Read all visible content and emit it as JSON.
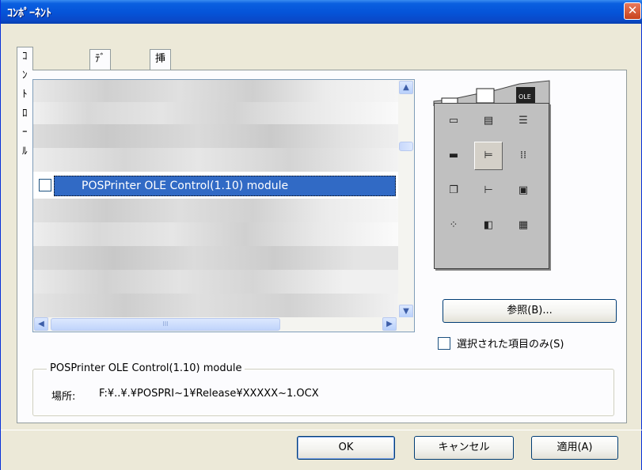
{
  "window": {
    "title": "ｺﾝﾎﾟｰﾈﾝﾄ",
    "close_glyph": "✕"
  },
  "tabs": [
    {
      "label": "ｺﾝﾄﾛｰﾙ",
      "active": true
    },
    {
      "label": "ﾃﾞｻﾞｲﾅ",
      "active": false
    },
    {
      "label": "挿入可能なｵﾌﾞｼﾞｪｸﾄ",
      "active": false
    }
  ],
  "list": {
    "selected_item": "POSPrinter OLE Control(1.10) module"
  },
  "scroll": {
    "up": "▲",
    "down": "▼",
    "left": "◀",
    "right": "▶",
    "grip": "III"
  },
  "palette": {
    "icons": [
      "chart-icon",
      "stack-icon",
      "ole-icon",
      "frame-icon",
      "label-icon",
      "form-icon",
      "rect-icon",
      "tree-icon",
      "grid-icon",
      "window-icon",
      "list-icon",
      "db-icon",
      "dots-icon",
      "image-icon",
      "panel-icon"
    ]
  },
  "browse_button": "参照(B)...",
  "selected_only": {
    "label": "選択された項目のみ(S)",
    "checked": false
  },
  "group": {
    "title": "POSPrinter OLE Control(1.10) module",
    "location_label": "場所:",
    "location_value": "F:¥..¥.¥POSPRI~1¥Release¥XXXXX~1.OCX"
  },
  "buttons": {
    "ok": "OK",
    "cancel": "キャンセル",
    "apply": "適用(A)"
  }
}
